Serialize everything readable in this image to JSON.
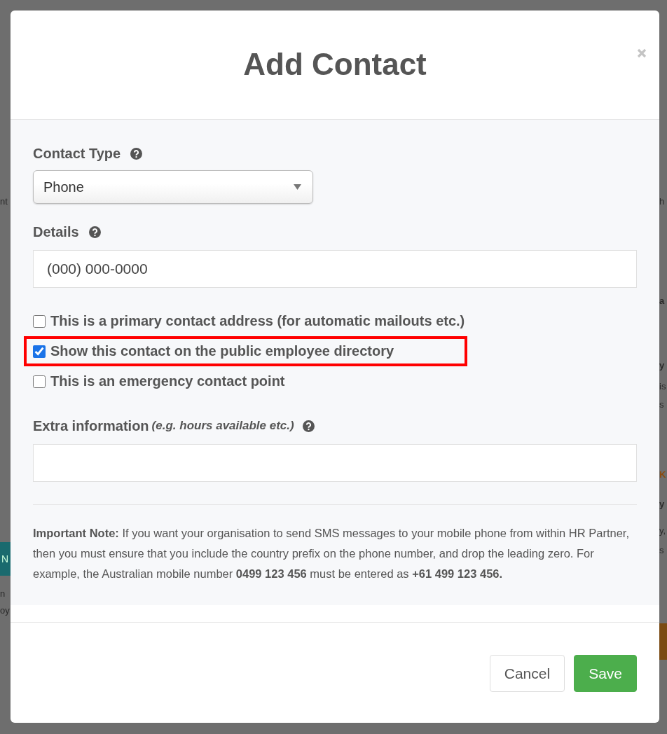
{
  "background": {
    "left": [
      {
        "kind": "text",
        "text": "nt"
      },
      {
        "kind": "button",
        "text": "N"
      },
      {
        "kind": "text",
        "text": "n"
      },
      {
        "kind": "text",
        "text": "oy"
      }
    ],
    "right": [
      {
        "kind": "text",
        "text": "h"
      },
      {
        "kind": "bold",
        "text": "a"
      },
      {
        "kind": "bold",
        "text": "y"
      },
      {
        "kind": "text",
        "text": "is"
      },
      {
        "kind": "text",
        "text": "s"
      },
      {
        "kind": "accent",
        "text": "K"
      },
      {
        "kind": "bold",
        "text": "y"
      },
      {
        "kind": "text",
        "text": "y,"
      },
      {
        "kind": "text",
        "text": "s"
      }
    ]
  },
  "dialog": {
    "title": "Add Contact",
    "contact_type": {
      "label": "Contact Type",
      "value": "Phone"
    },
    "details": {
      "label": "Details",
      "placeholder": "(000) 000-0000"
    },
    "options": [
      {
        "label": "This is a primary contact address (for automatic mailouts etc.)",
        "checked": false,
        "highlighted": false
      },
      {
        "label": "Show this contact on the public employee directory",
        "checked": true,
        "highlighted": true
      },
      {
        "label": "This is an emergency contact point",
        "checked": false,
        "highlighted": false
      }
    ],
    "extra": {
      "label": "Extra information",
      "hint": "(e.g. hours available etc.)"
    },
    "note": "**Important Note:** If you want your organisation to send SMS messages to your mobile phone from within HR Partner, then you must ensure that you include the country prefix on the phone number, and drop the leading zero. For example, the Australian mobile number **0499 123 456** must be entered as **+61 499 123 456.**",
    "buttons": [
      {
        "kind": "default",
        "label": "Cancel"
      },
      {
        "kind": "primary",
        "label": "Save"
      }
    ]
  }
}
